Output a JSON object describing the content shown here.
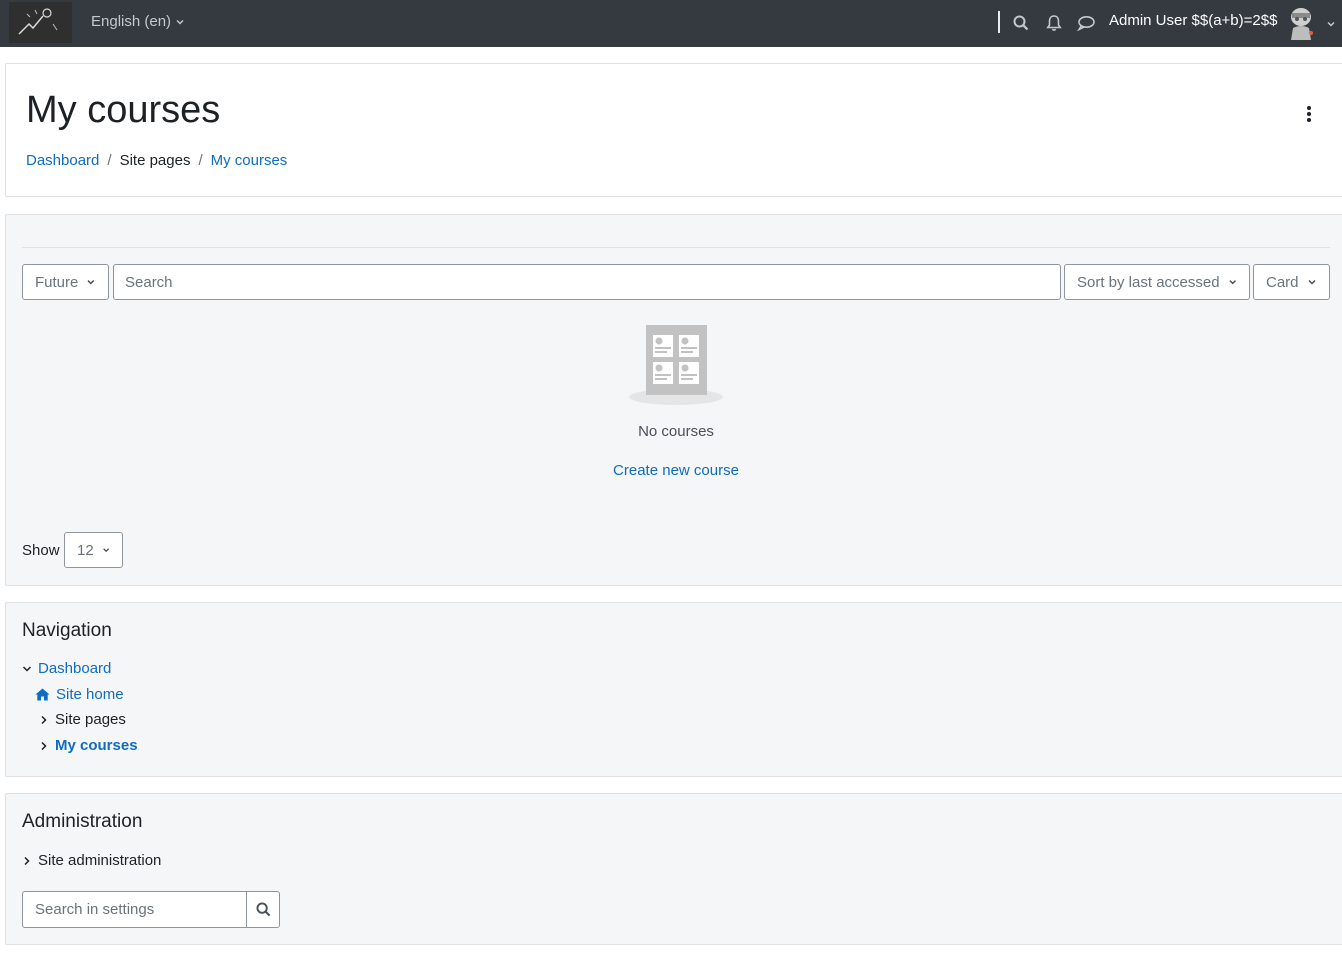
{
  "navbar": {
    "language": "English (en)",
    "user_name": "Admin User $$(a+b)=2$$",
    "icons": [
      "search-icon",
      "bell-icon",
      "chat-icon",
      "chevron-down-icon"
    ]
  },
  "header": {
    "title": "My courses",
    "breadcrumb": {
      "item1": "Dashboard",
      "item2": "Site pages",
      "item3": "My courses"
    }
  },
  "courses": {
    "grouping_filter": "Future",
    "search_placeholder": "Search",
    "sort_filter": "Sort by last accessed",
    "view_filter": "Card",
    "empty_message": "No courses",
    "create_link": "Create new course",
    "show_label": "Show",
    "show_count": "12"
  },
  "navigation": {
    "title": "Navigation",
    "items": {
      "dashboard": "Dashboard",
      "site_home": "Site home",
      "site_pages": "Site pages",
      "my_courses": "My courses"
    }
  },
  "administration": {
    "title": "Administration",
    "site_admin": "Site administration",
    "search_placeholder": "Search in settings"
  },
  "colors": {
    "navbar": "#343a40",
    "link": "#0f6cbf",
    "card_bg": "#f5f6f7",
    "border": "#dee2e6"
  }
}
